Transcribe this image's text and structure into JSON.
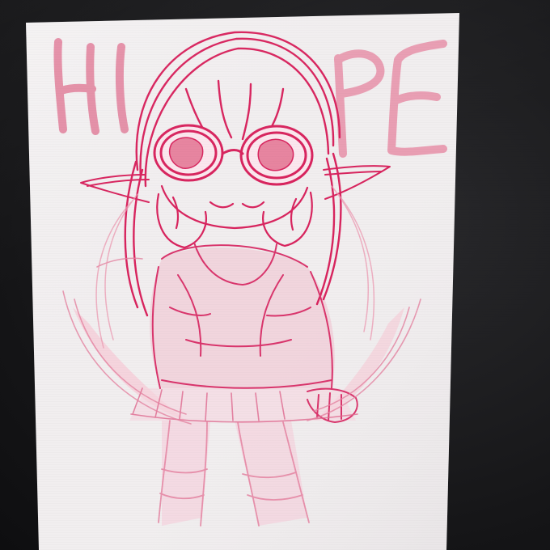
{
  "photo": {
    "subject": "",
    "handwritten_lettering": "HI PE"
  },
  "palette": {
    "paper": "#f1eeef",
    "stroke_dark": "#d8245e",
    "stroke_mid": "#e0527f",
    "stroke_light": "#f0a6bd",
    "fill_soft": "#f6c9d6",
    "monitor": "#1c1c1e"
  }
}
